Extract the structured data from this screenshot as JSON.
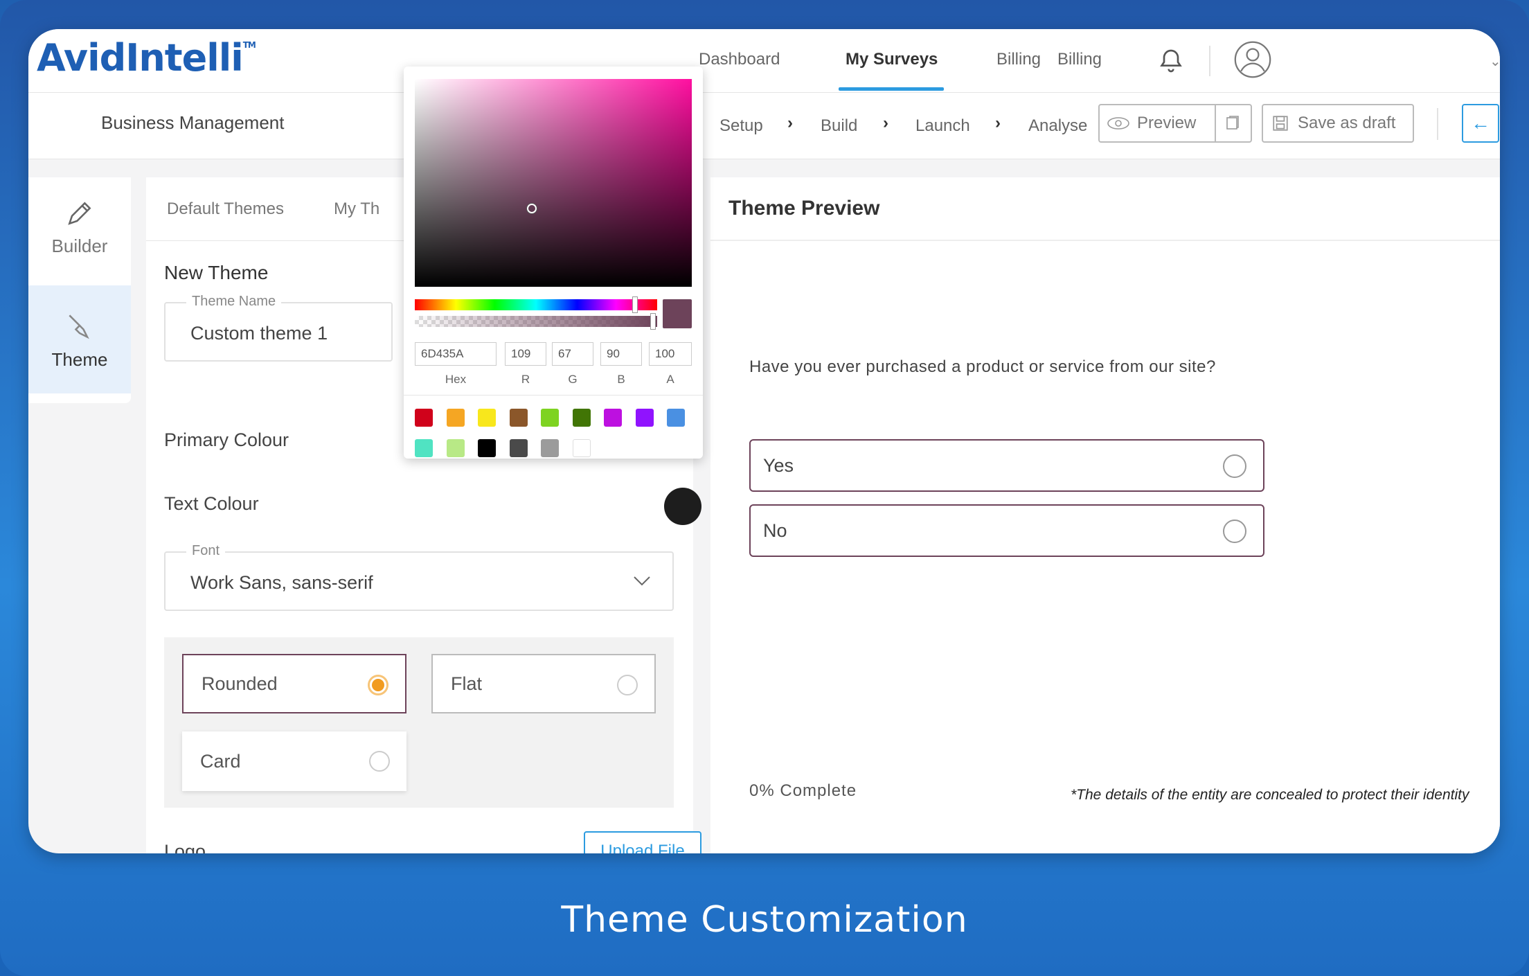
{
  "app": {
    "logo_text": "AvidIntelli",
    "logo_mark": "TM",
    "caption": "Theme Customization"
  },
  "header": {
    "nav": [
      "Dashboard",
      "My Surveys",
      "Billing",
      "Billing"
    ],
    "active_nav": "My Surveys"
  },
  "subheader": {
    "title": "Business Management",
    "steps": [
      "Setup",
      "Build",
      "Launch",
      "Analyse"
    ],
    "preview_label": "Preview",
    "save_label": "Save as draft"
  },
  "rail": {
    "items": [
      {
        "label": "Builder",
        "icon": "pencil-icon"
      },
      {
        "label": "Theme",
        "icon": "brush-icon",
        "active": true
      }
    ]
  },
  "editor": {
    "tabs": [
      "Default Themes",
      "My Th"
    ],
    "section_title": "New Theme",
    "theme_name_legend": "Theme Name",
    "theme_name_value": "Custom theme 1",
    "primary_colour_label": "Primary Colour",
    "text_colour_label": "Text Colour",
    "font_legend": "Font",
    "font_value": "Work Sans, sans-serif",
    "shapes": [
      {
        "label": "Rounded",
        "selected": true
      },
      {
        "label": "Flat",
        "selected": false
      },
      {
        "label": "Card",
        "selected": false
      }
    ],
    "logo_label": "Logo",
    "upload_label": "Upload File"
  },
  "picker": {
    "hex": "6D435A",
    "r": "109",
    "g": "67",
    "b": "90",
    "a": "100",
    "labels": {
      "hex": "Hex",
      "r": "R",
      "g": "G",
      "b": "B",
      "a": "A"
    },
    "swatches": [
      "#d0021b",
      "#f5a623",
      "#f8e71c",
      "#8b572a",
      "#7ed321",
      "#417505",
      "#bd10e0",
      "#9013fe",
      "#4a90e2",
      "#50e3c2",
      "#b8e986",
      "#000000",
      "#4a4a4a",
      "#9b9b9b",
      "#ffffff"
    ],
    "selected_color": "#6D435A"
  },
  "preview": {
    "title": "Theme Preview",
    "question": "Have you ever purchased a product or service from our site?",
    "answers": [
      "Yes",
      "No"
    ],
    "progress": "0% Complete",
    "note": "*The details of the entity are concealed to protect their identity"
  }
}
